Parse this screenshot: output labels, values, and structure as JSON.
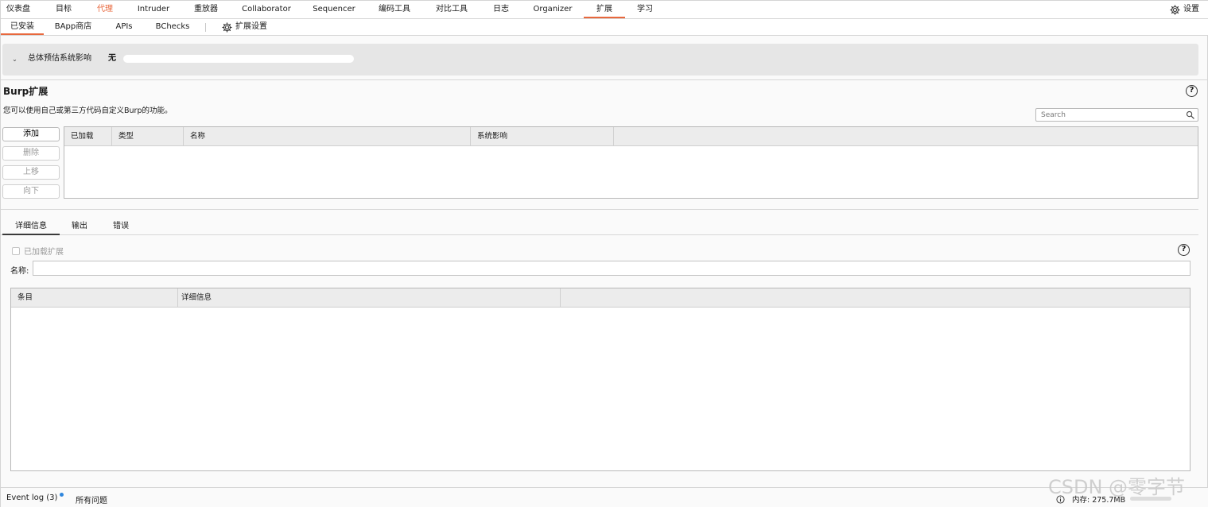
{
  "colors": {
    "accent": "#e8683d",
    "notify_dot": "#2f86dd"
  },
  "top_nav": {
    "items": [
      "仪表盘",
      "目标",
      "代理",
      "Intruder",
      "重放器",
      "Collaborator",
      "Sequencer",
      "编码工具",
      "对比工具",
      "日志",
      "Organizer",
      "扩展",
      "学习"
    ],
    "active": "扩展",
    "settings_label": "设置",
    "settings_icon": "gear-icon"
  },
  "sub_nav": {
    "items": [
      "已安装",
      "BApp商店",
      "APIs",
      "BChecks"
    ],
    "active": "已安装",
    "extension_settings_label": "扩展设置"
  },
  "impact": {
    "label": "总体预估系统影响",
    "value": "无"
  },
  "extensions": {
    "title": "Burp扩展",
    "description": "您可以使用自己或第三方代码自定义Burp的功能。",
    "search_placeholder": "Search",
    "buttons": {
      "add": "添加",
      "remove": "删除",
      "up": "上移",
      "down": "向下"
    },
    "columns": [
      "已加载",
      "类型",
      "名称",
      "系统影响"
    ],
    "rows": []
  },
  "details": {
    "tabs": [
      "详细信息",
      "输出",
      "错误"
    ],
    "active_tab": "详细信息",
    "loaded_checkbox_label": "已加载扩展",
    "name_label": "名称:",
    "name_value": "",
    "columns": [
      "条目",
      "详细信息"
    ],
    "rows": []
  },
  "status_bar": {
    "event_log": "Event log (3)",
    "all_issues": "所有问题",
    "memory": "内存: 275.7MB"
  },
  "watermark": "CSDN @零字节"
}
